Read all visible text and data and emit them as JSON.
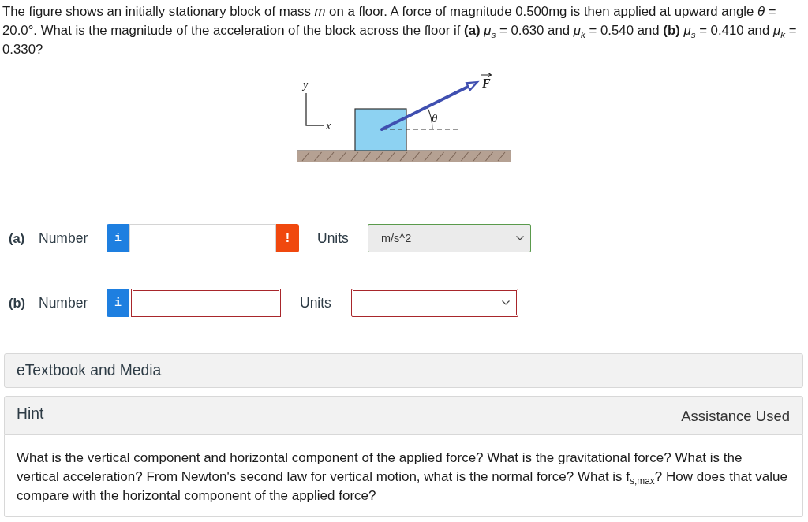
{
  "question": "The figure shows an initially stationary block of mass *m* on a floor. A force of magnitude 0.500mg is then applied at upward angle *θ* = 20.0°. What is the magnitude of the acceleration of the block across the floor if **(a)** *μ*$_{s}$ = 0.630 and *μ*$_{k}$ = 0.540 and **(b)** *μ*$_{s}$ = 0.410 and *μ*$_{k}$ = 0.330?",
  "figure": {
    "y_axis": "y",
    "x_axis": "x",
    "angle": "θ",
    "force": "F"
  },
  "parts": [
    {
      "label": "(a)",
      "number_label": "Number",
      "info": "i",
      "number": {
        "invalid": false,
        "flag": "!"
      },
      "units_label": "Units",
      "units": {
        "valid": true,
        "invalid": false,
        "value": "m/s^2"
      }
    },
    {
      "label": "(b)",
      "number_label": "Number",
      "info": "i",
      "number": {
        "invalid": true
      },
      "units_label": "Units",
      "units": {
        "valid": false,
        "invalid": true
      }
    }
  ],
  "panels": [
    {
      "title": "eTextbook and Media",
      "expanded": false
    },
    {
      "title": "Hint",
      "note": "Assistance Used",
      "expanded": true,
      "body": "What is the vertical component and horizontal component of the applied force? What is the gravitational force? What is the vertical acceleration? From Newton's second law for vertical motion, what is the normal force? What is f$_{s,max}$? How does that value compare with the horizontal component of the applied force?"
    }
  ]
}
